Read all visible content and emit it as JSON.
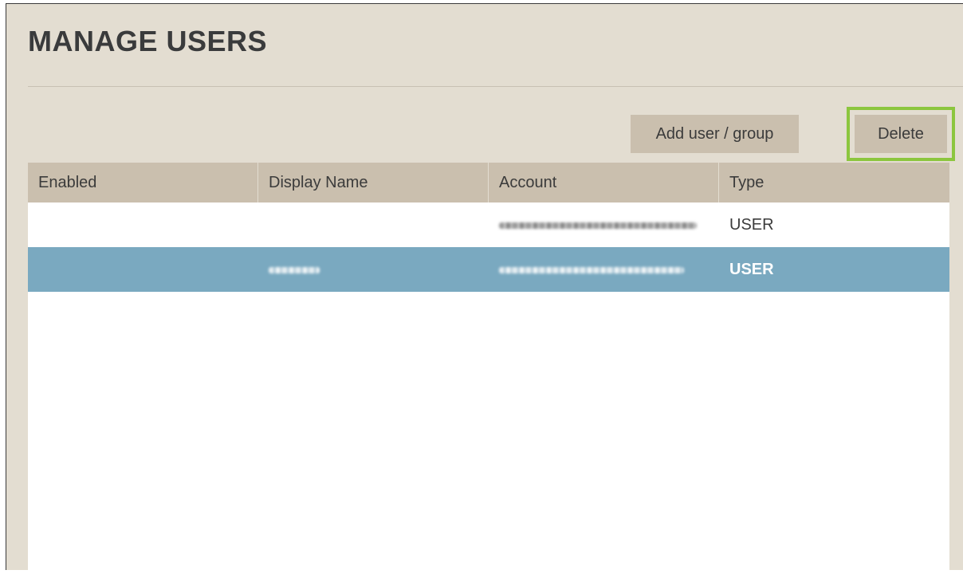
{
  "page": {
    "title": "MANAGE USERS"
  },
  "toolbar": {
    "add_label": "Add user / group",
    "delete_label": "Delete"
  },
  "table": {
    "columns": [
      "Enabled",
      "Display Name",
      "Account",
      "Type"
    ],
    "rows": [
      {
        "enabled": "",
        "display_name": "",
        "account": "",
        "type": "USER",
        "selected": false
      },
      {
        "enabled": "",
        "display_name": "",
        "account": "",
        "type": "USER",
        "selected": true
      }
    ]
  },
  "colors": {
    "background": "#e3ddd1",
    "header": "#cabfae",
    "selected_row": "#7aa9c0",
    "highlight_border": "#8cc63e"
  }
}
